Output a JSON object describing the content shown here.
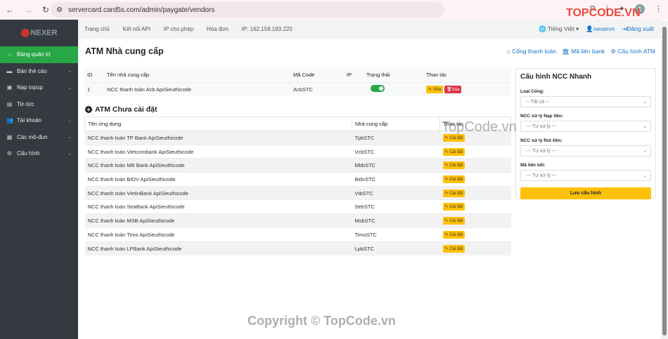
{
  "browser": {
    "url": "servercard.card5s.com/admin/paygate/vendors",
    "avatar": "E"
  },
  "logo": "NEXER",
  "sidebar": {
    "items": [
      {
        "label": "Bảng quản trị",
        "icon": "home-icon",
        "active": true,
        "chev": false
      },
      {
        "label": "Bán thẻ cào",
        "icon": "card-icon",
        "chev": true
      },
      {
        "label": "Nạp topup",
        "icon": "topup-icon",
        "chev": true
      },
      {
        "label": "Tin tức",
        "icon": "news-icon",
        "chev": false
      },
      {
        "label": "Tài khoản",
        "icon": "users-icon",
        "chev": true
      },
      {
        "label": "Các mô-đun",
        "icon": "module-icon",
        "chev": true
      },
      {
        "label": "Cấu hình",
        "icon": "gear-icon",
        "chev": true
      }
    ]
  },
  "topbar": {
    "links": [
      "Trang chủ",
      "Kết nối API",
      "IP cho phép",
      "Hóa đơn"
    ],
    "ip": "IP: 162.158.193.220",
    "language": "Tiếng Việt",
    "user": "nexervn",
    "logout": "Đăng xuất"
  },
  "page": {
    "title": "ATM Nhà cung cấp",
    "actions": [
      "Cổng thanh toán",
      "Mã liên bank",
      "Cấu hình ATM"
    ]
  },
  "installed": {
    "headers": [
      "ID",
      "Tên nhà cung cấp",
      "Mã Code",
      "IP",
      "Trạng thái",
      "Thao tác"
    ],
    "rows": [
      {
        "id": "1",
        "name": "NCC thanh toán Acb ApiSieuthicode",
        "code": "AcbSTC",
        "ip": "",
        "enabled": true
      }
    ],
    "edit": "Sửa",
    "delete": "Xóa"
  },
  "uninstalled": {
    "title": "ATM Chưa cài đặt",
    "headers": [
      "Tên ứng dụng",
      "Nhà cung cấp",
      "Thao tác"
    ],
    "install": "Cài đặt",
    "rows": [
      [
        "NCC thanh toán TP Bank ApiSieuthicode",
        "TpbSTC"
      ],
      [
        "NCC thanh toán Vietcombank ApiSieuthicode",
        "VcbSTC"
      ],
      [
        "NCC thanh toán MB Bank ApiSieuthicode",
        "MbbSTC"
      ],
      [
        "NCC thanh toán BIDV ApiSieuthicode",
        "BidvSTC"
      ],
      [
        "NCC thanh toán VietinBank ApiSieuthicode",
        "VtbSTC"
      ],
      [
        "NCC thanh toán SeaBank ApiSieuthicode",
        "SebSTC"
      ],
      [
        "NCC thanh toán MSB ApiSieuthicode",
        "MsbSTC"
      ],
      [
        "NCC thanh toán Timo ApiSieuthicode",
        "TimoSTC"
      ],
      [
        "NCC thanh toán LPBank ApiSieuthicode",
        "LpbSTC"
      ]
    ]
  },
  "quick": {
    "title": "Cấu hình NCC Nhanh",
    "fields": [
      {
        "label": "Loại Cổng:",
        "value": "-- Tất cả --"
      },
      {
        "label": "NCC xử lý Nạp tiền:",
        "value": "--- Tự xử lý ---"
      },
      {
        "label": "NCC xử lý Rút tiền:",
        "value": "--- Tự xử lý ---"
      },
      {
        "label": "Mã liên kết:",
        "value": "--- Tự xử lý ---"
      }
    ],
    "save": "Lưu cấu hình"
  },
  "watermarks": {
    "brand": "TOPCODE.VN",
    "mid": "TopCode.vn",
    "bottom": "Copyright © TopCode.vn"
  }
}
